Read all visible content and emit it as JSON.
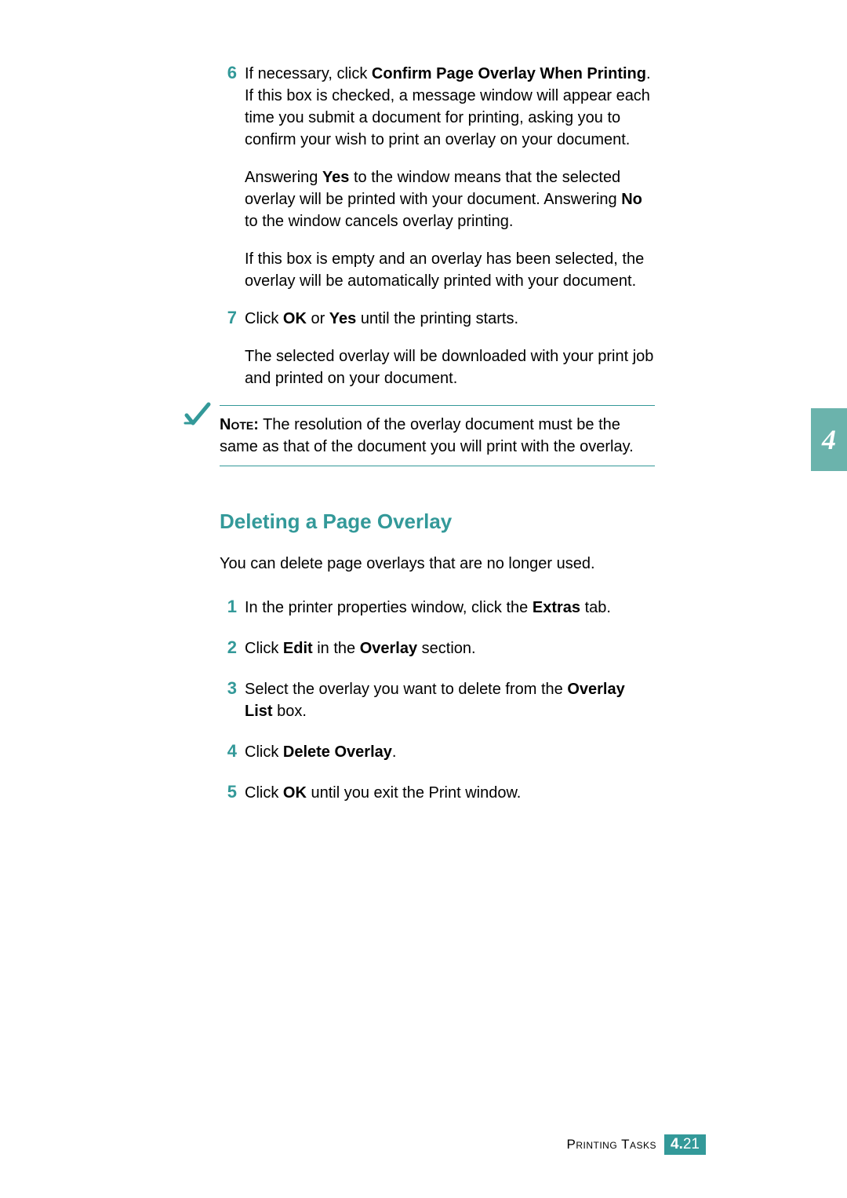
{
  "chapter_tab": "4",
  "section1": {
    "steps": [
      {
        "num": "6",
        "paragraphs": [
          {
            "segments": [
              {
                "t": "If necessary, click "
              },
              {
                "t": "Confirm Page Overlay When Printing",
                "b": true
              },
              {
                "t": ". If this box is checked, a message window will appear each time you submit a document for printing, asking you to confirm your wish to print an overlay on your document."
              }
            ]
          },
          {
            "segments": [
              {
                "t": "Answering "
              },
              {
                "t": "Yes",
                "b": true
              },
              {
                "t": " to the window means that the selected overlay will be printed with your document. Answering "
              },
              {
                "t": "No",
                "b": true
              },
              {
                "t": " to the window cancels overlay printing."
              }
            ]
          },
          {
            "segments": [
              {
                "t": "If this box is empty and an overlay has been selected, the overlay will be automatically printed with your document."
              }
            ]
          }
        ]
      },
      {
        "num": "7",
        "paragraphs": [
          {
            "segments": [
              {
                "t": "Click "
              },
              {
                "t": "OK",
                "b": true
              },
              {
                "t": " or "
              },
              {
                "t": "Yes",
                "b": true
              },
              {
                "t": " until the printing starts."
              }
            ]
          },
          {
            "segments": [
              {
                "t": "The selected overlay will be downloaded with your print job and printed on your document."
              }
            ]
          }
        ]
      }
    ]
  },
  "note": {
    "label": "Note:",
    "text": " The resolution of the overlay document must be the same as that of the document you will print with the overlay."
  },
  "section2": {
    "heading": "Deleting a Page Overlay",
    "intro": "You can delete page overlays that are no longer used.",
    "steps": [
      {
        "num": "1",
        "paragraphs": [
          {
            "segments": [
              {
                "t": "In the printer properties window, click the "
              },
              {
                "t": "Extras",
                "b": true
              },
              {
                "t": " tab."
              }
            ]
          }
        ]
      },
      {
        "num": "2",
        "paragraphs": [
          {
            "segments": [
              {
                "t": "Click "
              },
              {
                "t": "Edit",
                "b": true
              },
              {
                "t": " in the "
              },
              {
                "t": "Overlay",
                "b": true
              },
              {
                "t": " section."
              }
            ]
          }
        ]
      },
      {
        "num": "3",
        "paragraphs": [
          {
            "segments": [
              {
                "t": "Select the overlay you want to delete from the "
              },
              {
                "t": "Overlay List",
                "b": true
              },
              {
                "t": " box."
              }
            ]
          }
        ]
      },
      {
        "num": "4",
        "paragraphs": [
          {
            "segments": [
              {
                "t": "Click "
              },
              {
                "t": "Delete Overlay",
                "b": true
              },
              {
                "t": "."
              }
            ]
          }
        ]
      },
      {
        "num": "5",
        "paragraphs": [
          {
            "segments": [
              {
                "t": "Click "
              },
              {
                "t": "OK",
                "b": true
              },
              {
                "t": " until you exit the Print window."
              }
            ]
          }
        ]
      }
    ]
  },
  "footer": {
    "title": "Printing Tasks",
    "chapter": "4.",
    "page": "21"
  }
}
